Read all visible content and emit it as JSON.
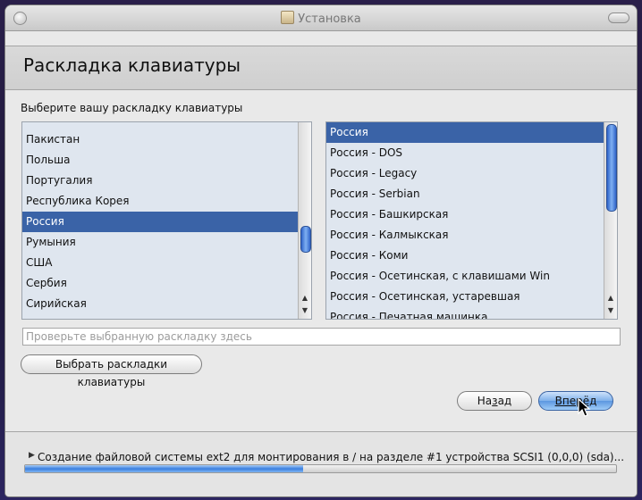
{
  "window": {
    "title": "Установка"
  },
  "header": {
    "title": "Раскладка клавиатуры"
  },
  "prompt": "Выберите вашу раскладку клавиатуры",
  "countries": {
    "items": [
      "Пакистан",
      "Польша",
      "Португалия",
      "Республика Корея",
      "Россия",
      "Румыния",
      "США",
      "Сербия",
      "Сирийская"
    ],
    "selected": "Россия"
  },
  "variants": {
    "items": [
      "Россия",
      "Россия - DOS",
      "Россия - Legacy",
      "Россия - Serbian",
      "Россия - Башкирская",
      "Россия - Калмыкская",
      "Россия - Коми",
      "Россия - Осетинская, с клавишами Win",
      "Россия - Осетинская, устаревшая",
      "Россия - Печатная машинка"
    ],
    "selected": "Россия"
  },
  "test_field": {
    "placeholder": "Проверьте выбранную раскладку здесь"
  },
  "buttons": {
    "choose_layouts": "Выбрать раскладки клавиатуры",
    "back": "Назад",
    "forward": "Вперёд"
  },
  "status": {
    "text": "Создание файловой системы ext2 для монтирования в / на разделе #1 устройства SCSI1 (0,0,0) (sda)...",
    "progress": 0.47
  },
  "colors": {
    "selection": "#3a63a7",
    "accent": "#2f63c9"
  }
}
